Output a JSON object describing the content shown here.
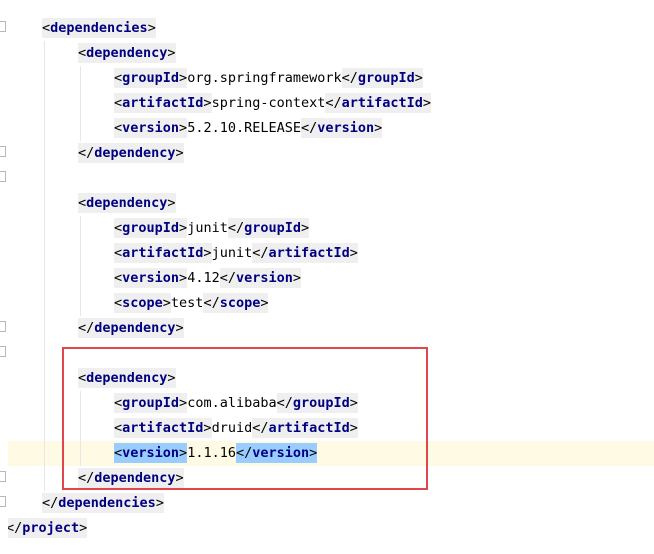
{
  "editor": {
    "lines": [
      {
        "indent": 0,
        "kind": "open",
        "tag": "dependencies"
      },
      {
        "indent": 1,
        "kind": "open",
        "tag": "dependency"
      },
      {
        "indent": 2,
        "kind": "elem",
        "tag": "groupId",
        "value": "org.springframework"
      },
      {
        "indent": 2,
        "kind": "elem",
        "tag": "artifactId",
        "value": "spring-context"
      },
      {
        "indent": 2,
        "kind": "elem",
        "tag": "version",
        "value": "5.2.10.RELEASE"
      },
      {
        "indent": 1,
        "kind": "close",
        "tag": "dependency"
      },
      {
        "indent": 0,
        "kind": "blank"
      },
      {
        "indent": 1,
        "kind": "open",
        "tag": "dependency"
      },
      {
        "indent": 2,
        "kind": "elem",
        "tag": "groupId",
        "value": "junit"
      },
      {
        "indent": 2,
        "kind": "elem",
        "tag": "artifactId",
        "value": "junit"
      },
      {
        "indent": 2,
        "kind": "elem",
        "tag": "version",
        "value": "4.12"
      },
      {
        "indent": 2,
        "kind": "elem",
        "tag": "scope",
        "value": "test"
      },
      {
        "indent": 1,
        "kind": "close",
        "tag": "dependency"
      },
      {
        "indent": 0,
        "kind": "blank"
      },
      {
        "indent": 1,
        "kind": "open",
        "tag": "dependency"
      },
      {
        "indent": 2,
        "kind": "elem",
        "tag": "groupId",
        "value": "com.alibaba"
      },
      {
        "indent": 2,
        "kind": "elem",
        "tag": "artifactId",
        "value": "druid"
      },
      {
        "indent": 2,
        "kind": "elem",
        "tag": "version",
        "value": "1.1.16",
        "selected": true,
        "caret": true
      },
      {
        "indent": 1,
        "kind": "close",
        "tag": "dependency"
      },
      {
        "indent": 0,
        "kind": "close",
        "tag": "dependencies"
      },
      {
        "indent": -1,
        "kind": "close",
        "tag": "project"
      }
    ]
  },
  "colors": {
    "tag_name": "#000080",
    "tag_background": "#efefef",
    "selection": "#99ccff",
    "caret_line": "#fffae3",
    "annotation_box": "#e0474c"
  }
}
